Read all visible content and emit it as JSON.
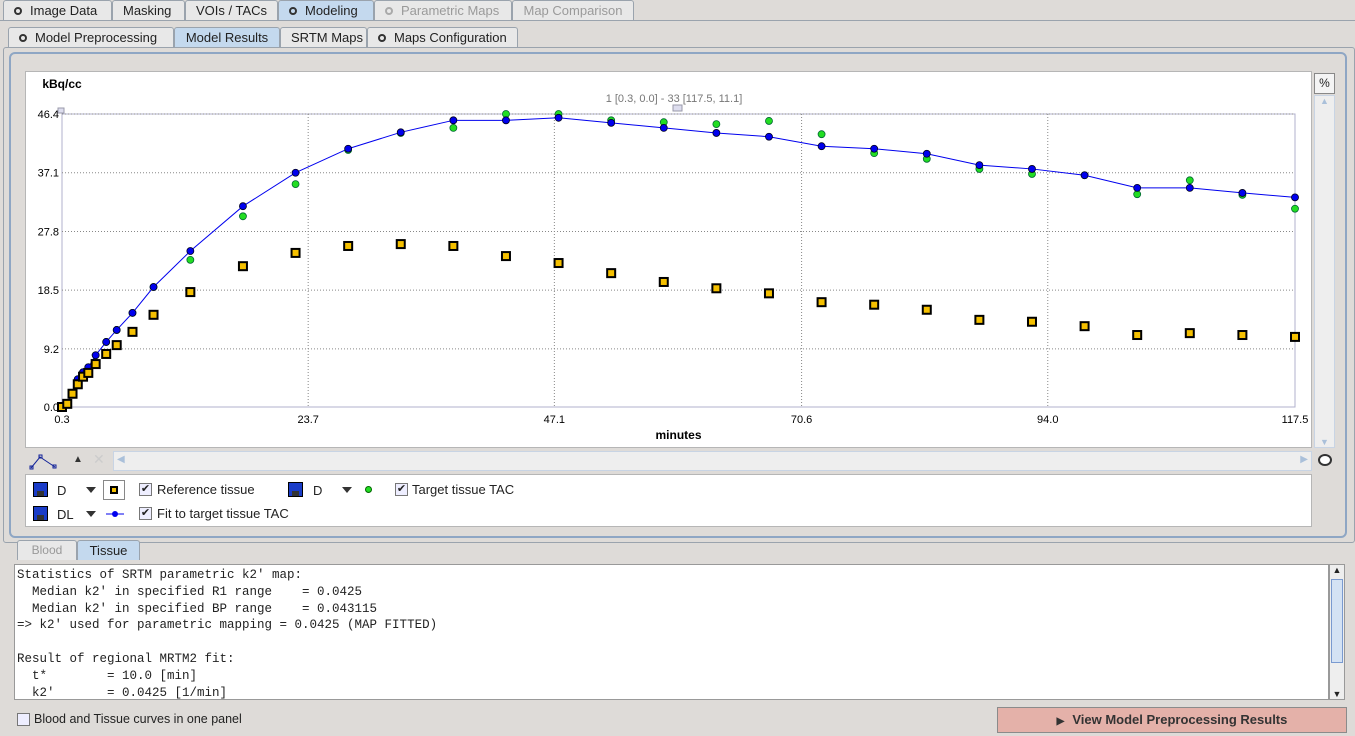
{
  "main_tabs": [
    {
      "label": "Image Data",
      "icon": "radio-dot"
    },
    {
      "label": "Masking"
    },
    {
      "label": "VOIs / TACs"
    },
    {
      "label": "Modeling",
      "icon": "radio-dot",
      "selected": true
    },
    {
      "label": "Parametric Maps",
      "icon": "radio-dot",
      "disabled": true
    },
    {
      "label": "Map Comparison",
      "disabled": true
    }
  ],
  "sub_tabs": [
    {
      "label": "Model Preprocessing",
      "icon": "radio-dot"
    },
    {
      "label": "Model Results",
      "selected": true
    },
    {
      "label": "SRTM Maps"
    },
    {
      "label": "Maps Configuration",
      "icon": "radio-dot"
    }
  ],
  "chart_toolbar": {
    "percent_label": "%"
  },
  "chart_data": {
    "type": "scatter",
    "ylabel": "kBq/cc",
    "xlabel": "minutes",
    "range_label": "1 [0.3, 0.0] - 33 [117.5, 11.1]",
    "xlim": [
      0.3,
      117.5
    ],
    "ylim": [
      0,
      46.4
    ],
    "xticks": [
      "0.3",
      "23.7",
      "47.1",
      "70.6",
      "94.0",
      "117.5"
    ],
    "yticks": [
      "0.0",
      "9.2",
      "18.5",
      "27.8",
      "37.1",
      "46.4"
    ],
    "grid": true,
    "x": [
      0.3,
      0.8,
      1.3,
      1.8,
      2.3,
      2.8,
      3.5,
      4.5,
      5.5,
      7,
      9,
      12.5,
      17.5,
      22.5,
      27.5,
      32.5,
      37.5,
      42.5,
      47.5,
      52.5,
      57.5,
      62.5,
      67.5,
      72.5,
      77.5,
      82.5,
      87.5,
      92.5,
      97.5,
      102.5,
      107.5,
      112.5,
      117.5
    ],
    "series": [
      {
        "name": "Reference tissue",
        "marker": "square",
        "color": "#f5c000",
        "values": [
          0,
          0.5,
          2.1,
          3.6,
          4.8,
          5.4,
          6.8,
          8.4,
          9.8,
          11.9,
          14.6,
          18.2,
          22.3,
          24.4,
          25.5,
          25.8,
          25.5,
          23.9,
          22.8,
          21.2,
          19.8,
          18.8,
          18.0,
          16.6,
          16.2,
          15.4,
          13.8,
          13.5,
          12.8,
          11.4,
          11.7,
          11.4,
          11.1
        ]
      },
      {
        "name": "Target tissue TAC",
        "marker": "circle",
        "color": "#22dd22",
        "values": [
          0,
          0.5,
          2.2,
          4.4,
          5.5,
          6.3,
          8.2,
          10.3,
          12.2,
          14.9,
          19.0,
          23.3,
          30.2,
          35.3,
          40.7,
          43.4,
          44.2,
          46.4,
          46.4,
          45.4,
          45.1,
          44.8,
          45.3,
          43.2,
          40.2,
          39.3,
          37.7,
          36.9,
          36.7,
          33.7,
          35.9,
          33.6,
          31.4
        ]
      },
      {
        "name": "Fit to target tissue TAC",
        "marker": "circle-line",
        "color": "#0000ee",
        "values": [
          0,
          0.5,
          2.2,
          4.4,
          5.5,
          6.3,
          8.2,
          10.3,
          12.2,
          14.9,
          19.0,
          24.7,
          31.8,
          37.1,
          40.9,
          43.5,
          45.4,
          45.4,
          45.8,
          45.0,
          44.2,
          43.4,
          42.8,
          41.3,
          40.9,
          40.1,
          38.3,
          37.7,
          36.7,
          34.7,
          34.7,
          33.9,
          33.2
        ]
      }
    ]
  },
  "legend": [
    {
      "style": "D",
      "label": "Reference tissue",
      "checked": true
    },
    {
      "style": "D",
      "label": "Target tissue TAC",
      "checked": true
    },
    {
      "style": "DL",
      "label": "Fit to target tissue TAC",
      "checked": true
    }
  ],
  "bottom_tabs": [
    {
      "label": "Blood"
    },
    {
      "label": "Tissue",
      "selected": true
    }
  ],
  "results_text": [
    "Statistics of SRTM parametric k2' map:",
    "  Median k2' in specified R1 range    = 0.0425",
    "  Median k2' in specified BP range    = 0.043115",
    "=> k2' used for parametric mapping = 0.0425 (MAP FITTED)",
    "",
    "Result of regional MRTM2 fit:",
    "  t*        = 10.0 [min]",
    "  k2'       = 0.0425 [1/min]"
  ],
  "one_panel_label": "Blood and Tissue curves in one panel",
  "view_button_label": "View Model Preprocessing Results"
}
